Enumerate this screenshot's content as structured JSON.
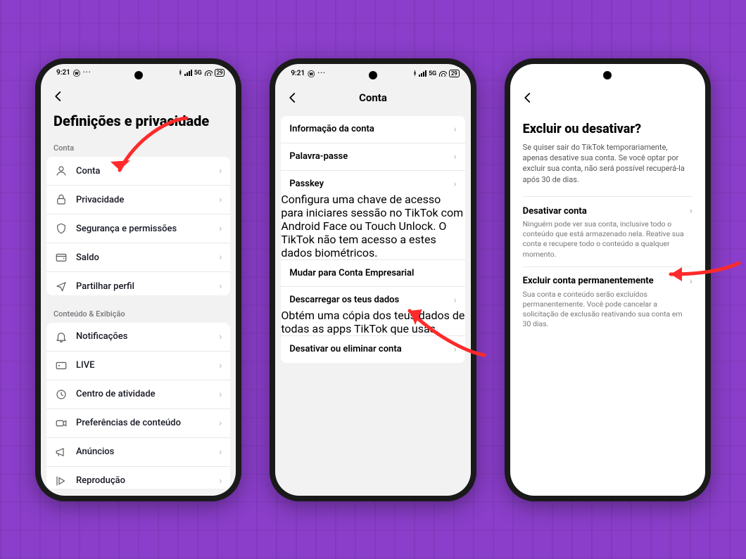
{
  "status": {
    "time": "9:21",
    "net_label": "5G",
    "battery_text": "29"
  },
  "screen1": {
    "title": "Definições e privacidade",
    "section_account": "Conta",
    "items_account": [
      {
        "icon": "user",
        "label": "Conta"
      },
      {
        "icon": "lock",
        "label": "Privacidade"
      },
      {
        "icon": "shield",
        "label": "Segurança e permissões"
      },
      {
        "icon": "wallet",
        "label": "Saldo"
      },
      {
        "icon": "share",
        "label": "Partilhar perfil"
      }
    ],
    "section_content": "Conteúdo & Exibição",
    "items_content": [
      {
        "icon": "bell",
        "label": "Notificações"
      },
      {
        "icon": "live",
        "label": "LIVE"
      },
      {
        "icon": "clock",
        "label": "Centro de atividade"
      },
      {
        "icon": "video",
        "label": "Preferências de conteúdo"
      },
      {
        "icon": "megaphone",
        "label": "Anúncios"
      },
      {
        "icon": "playback",
        "label": "Reprodução"
      }
    ]
  },
  "screen2": {
    "header": "Conta",
    "rows": [
      {
        "label": "Informação da conta",
        "desc": "",
        "chev": true
      },
      {
        "label": "Palavra-passe",
        "desc": "",
        "chev": true
      },
      {
        "label": "Passkey",
        "desc": "Configura uma chave de acesso para iniciares sessão no TikTok com Android Face ou Touch Unlock. O TikTok não tem acesso a estes dados biométricos.",
        "chev": true
      },
      {
        "label": "Mudar para Conta Empresarial",
        "desc": "",
        "chev": false
      },
      {
        "label": "Descarregar os teus dados",
        "desc": "Obtém uma cópia dos teus dados de todas as apps TikTok que usas.",
        "chev": true
      },
      {
        "label": "Desativar ou eliminar conta",
        "desc": "",
        "chev": true
      }
    ]
  },
  "screen3": {
    "title": "Excluir ou desativar?",
    "intro": "Se quiser sair do TikTok temporariamente, apenas desative sua conta. Se você optar por excluir sua conta, não será possível recuperá-la após 30 de dias.",
    "opt1_label": "Desativar conta",
    "opt1_desc": "Ninguém pode ver sua conta, inclusive todo o conteúdo que está armazenado nela. Reative sua conta e recupere todo o conteúdo a qualquer momento.",
    "opt2_label": "Excluir conta permanentemente",
    "opt2_desc": "Sua conta e conteúdo serão excluídos permanentemente. Você pode cancelar a solicitação de exclusão reativando sua conta em 30 dias."
  }
}
